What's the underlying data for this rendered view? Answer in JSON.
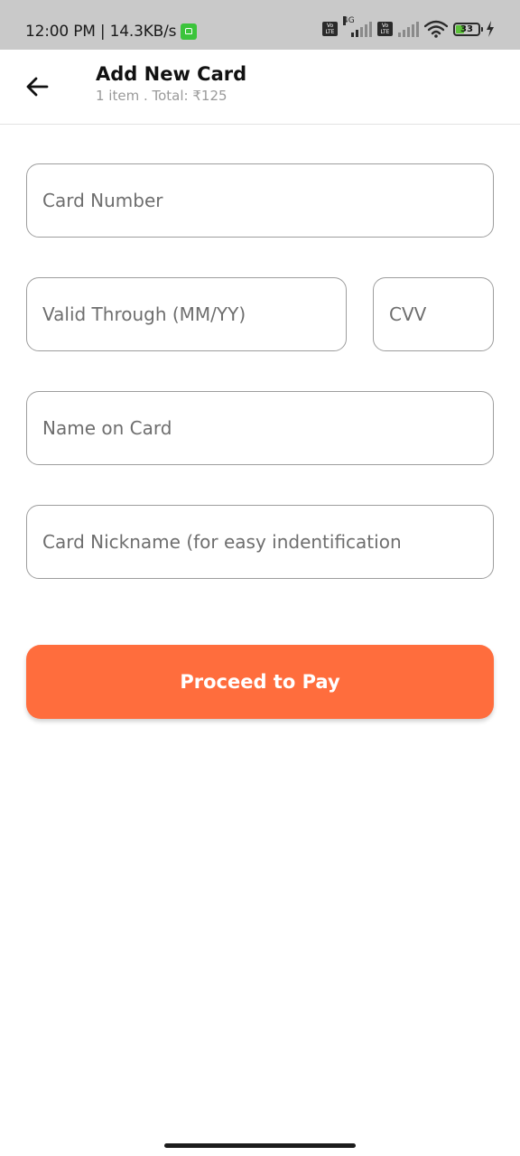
{
  "status_bar": {
    "time_speed": "12:00 PM | 14.3KB/s",
    "network_type": "4G",
    "volte_label": "Vo LTE",
    "battery_level": "33",
    "icons": [
      "app-notification-icon",
      "volte-icon",
      "signal-icon",
      "wifi-icon",
      "battery-icon",
      "charging-icon"
    ]
  },
  "header": {
    "title": "Add New Card",
    "subtitle": "1 item . Total: ₹125",
    "back_icon": "arrow-left-icon"
  },
  "form": {
    "card_number": {
      "value": "",
      "placeholder": "Card Number"
    },
    "valid_through": {
      "value": "",
      "placeholder": "Valid Through (MM/YY)"
    },
    "cvv": {
      "value": "",
      "placeholder": "CVV"
    },
    "name_on_card": {
      "value": "",
      "placeholder": "Name on Card"
    },
    "card_nickname": {
      "value": "",
      "placeholder": "Card Nickname (for easy indentification"
    }
  },
  "actions": {
    "proceed_label": "Proceed to Pay"
  },
  "colors": {
    "accent": "#ff6d3d",
    "status_bar_bg": "#c9c9c9",
    "field_border": "#9d9d9d",
    "subtitle_text": "#9a9a9a"
  }
}
